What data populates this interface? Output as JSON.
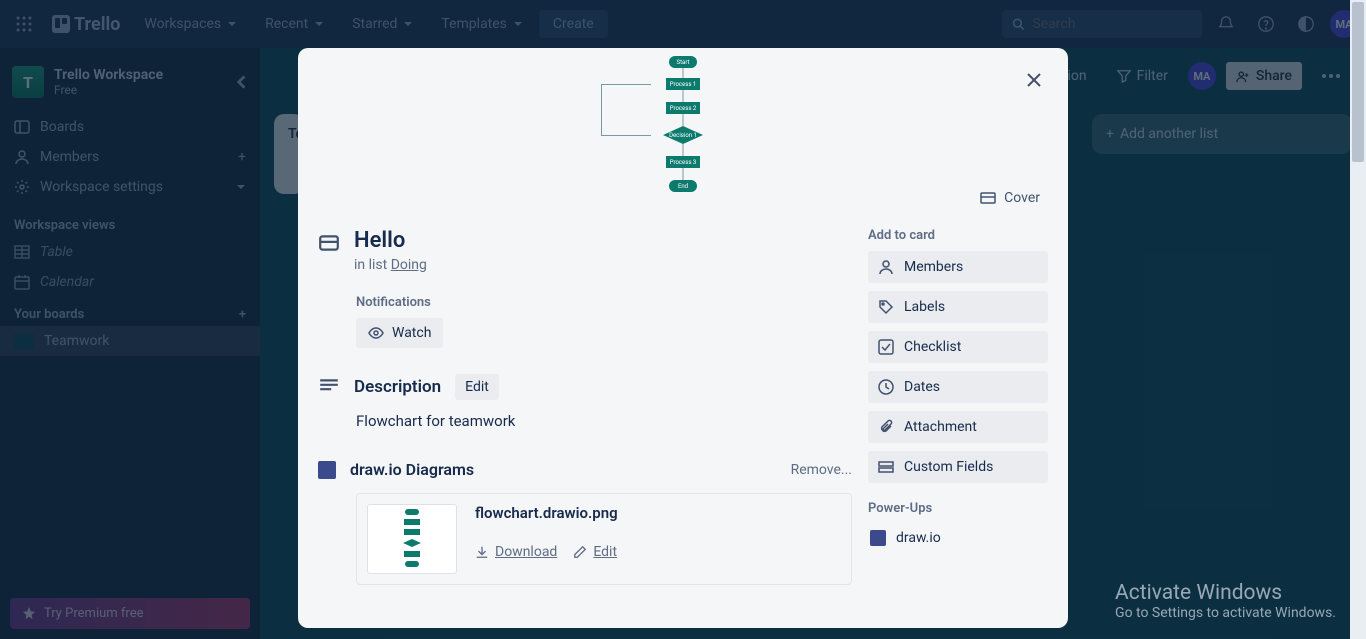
{
  "header": {
    "logo": "Trello",
    "nav": {
      "workspaces": "Workspaces",
      "recent": "Recent",
      "starred": "Starred",
      "templates": "Templates",
      "create": "Create"
    },
    "search_placeholder": "Search",
    "avatar": "MA"
  },
  "sidebar": {
    "workspace_name": "Trello Workspace",
    "workspace_plan": "Free",
    "workspace_initial": "T",
    "items": {
      "boards": "Boards",
      "members": "Members",
      "settings": "Workspace settings"
    },
    "views_heading": "Workspace views",
    "views": {
      "table": "Table",
      "calendar": "Calendar"
    },
    "your_boards": "Your boards",
    "board": "Teamwork",
    "premium": "Try Premium free"
  },
  "board": {
    "automation": "Automation",
    "filter": "Filter",
    "share": "Share",
    "list_todo": "To",
    "add_list": "Add another list"
  },
  "modal": {
    "cover_btn": "Cover",
    "title": "Hello",
    "in_list_prefix": "in list ",
    "in_list": "Doing",
    "notifications": "Notifications",
    "watch": "Watch",
    "description": "Description",
    "edit": "Edit",
    "desc_text": "Flowchart for teamwork",
    "drawio_heading": "draw.io Diagrams",
    "remove": "Remove...",
    "attachment_name": "flowchart.drawio.png",
    "download": "Download",
    "edit_att": "Edit",
    "flowchart": {
      "start": "Start",
      "p1": "Process 1",
      "p2": "Process 2",
      "dec": "Decision 1",
      "p3": "Process 3",
      "end": "End"
    },
    "side": {
      "add_heading": "Add to card",
      "members": "Members",
      "labels": "Labels",
      "checklist": "Checklist",
      "dates": "Dates",
      "attachment": "Attachment",
      "custom": "Custom Fields",
      "pu_heading": "Power-Ups",
      "drawio": "draw.io"
    }
  },
  "windows": {
    "t1": "Activate Windows",
    "t2": "Go to Settings to activate Windows."
  }
}
